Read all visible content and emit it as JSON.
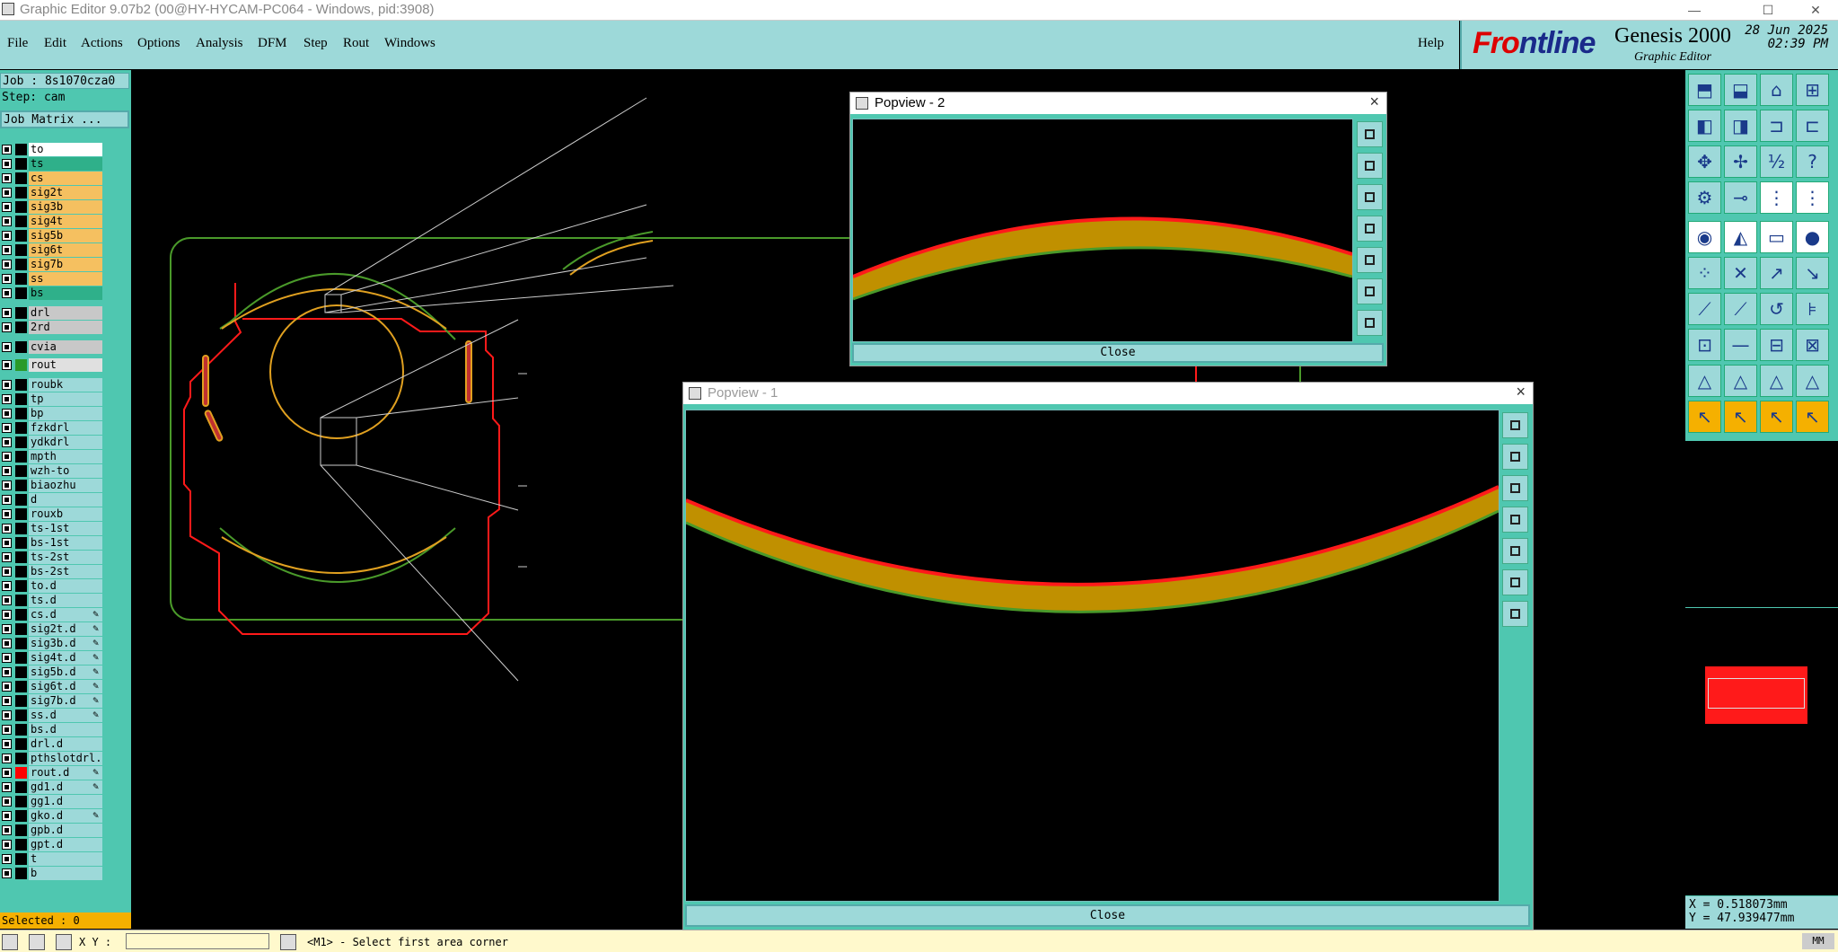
{
  "window": {
    "title": "Graphic Editor 9.07b2 (00@HY-HYCAM-PC064 - Windows, pid:3908)",
    "minimize": "—",
    "maximize": "☐",
    "close": "✕"
  },
  "menu": [
    "File",
    "Edit",
    "Actions",
    "Options",
    "Analysis",
    "DFM",
    "Step",
    "Rout",
    "Windows"
  ],
  "help_label": "Help",
  "brand": {
    "logo_main": "Fr",
    "logo_o": "o",
    "logo_rest": "ntline",
    "product": "Genesis 2000",
    "subtitle": "Graphic Editor",
    "date": "28 Jun 2025",
    "time": "02:39 PM"
  },
  "job": {
    "job_label": "Job : 8s1070cza0",
    "step_label": "Step: cam",
    "matrix_button": "Job Matrix ..."
  },
  "layers": [
    {
      "name": "to",
      "color": "#ffffff",
      "swatch": "#000000",
      "edit": ""
    },
    {
      "name": "ts",
      "color": "#2fb08a",
      "swatch": "#000000",
      "edit": ""
    },
    {
      "name": "cs",
      "color": "#f5c060",
      "swatch": "#000000",
      "edit": ""
    },
    {
      "name": "sig2t",
      "color": "#f5c060",
      "swatch": "#000000",
      "edit": ""
    },
    {
      "name": "sig3b",
      "color": "#f5c060",
      "swatch": "#000000",
      "edit": ""
    },
    {
      "name": "sig4t",
      "color": "#f5c060",
      "swatch": "#000000",
      "edit": ""
    },
    {
      "name": "sig5b",
      "color": "#f5c060",
      "swatch": "#000000",
      "edit": ""
    },
    {
      "name": "sig6t",
      "color": "#f5c060",
      "swatch": "#000000",
      "edit": ""
    },
    {
      "name": "sig7b",
      "color": "#f5c060",
      "swatch": "#000000",
      "edit": ""
    },
    {
      "name": "ss",
      "color": "#f5c060",
      "swatch": "#000000",
      "edit": ""
    },
    {
      "name": "bs",
      "color": "#2fb08a",
      "swatch": "#000000",
      "edit": ""
    },
    {
      "name": "drl",
      "color": "#c8c8c8",
      "swatch": "#000000",
      "edit": ""
    },
    {
      "name": "2rd",
      "color": "#c8c8c8",
      "swatch": "#000000",
      "edit": ""
    },
    {
      "name": "cvia",
      "color": "#c8c8c8",
      "swatch": "#000000",
      "edit": ""
    },
    {
      "name": "rout",
      "color": "#e0e0e0",
      "swatch": "#2a9a2a",
      "edit": ""
    },
    {
      "name": "roubk",
      "color": "#9dd9d9",
      "swatch": "#000000",
      "edit": ""
    },
    {
      "name": "tp",
      "color": "#9dd9d9",
      "swatch": "#000000",
      "edit": ""
    },
    {
      "name": "bp",
      "color": "#9dd9d9",
      "swatch": "#000000",
      "edit": ""
    },
    {
      "name": "fzkdrl",
      "color": "#9dd9d9",
      "swatch": "#000000",
      "edit": ""
    },
    {
      "name": "ydkdrl",
      "color": "#9dd9d9",
      "swatch": "#000000",
      "edit": ""
    },
    {
      "name": "mpth",
      "color": "#9dd9d9",
      "swatch": "#000000",
      "edit": ""
    },
    {
      "name": "wzh-to",
      "color": "#9dd9d9",
      "swatch": "#000000",
      "edit": ""
    },
    {
      "name": "biaozhu",
      "color": "#9dd9d9",
      "swatch": "#000000",
      "edit": ""
    },
    {
      "name": "d",
      "color": "#9dd9d9",
      "swatch": "#000000",
      "edit": ""
    },
    {
      "name": "rouxb",
      "color": "#9dd9d9",
      "swatch": "#000000",
      "edit": ""
    },
    {
      "name": "ts-1st",
      "color": "#9dd9d9",
      "swatch": "#000000",
      "edit": ""
    },
    {
      "name": "bs-1st",
      "color": "#9dd9d9",
      "swatch": "#000000",
      "edit": ""
    },
    {
      "name": "ts-2st",
      "color": "#9dd9d9",
      "swatch": "#000000",
      "edit": ""
    },
    {
      "name": "bs-2st",
      "color": "#9dd9d9",
      "swatch": "#000000",
      "edit": ""
    },
    {
      "name": "to.d",
      "color": "#9dd9d9",
      "swatch": "#000000",
      "edit": ""
    },
    {
      "name": "ts.d",
      "color": "#9dd9d9",
      "swatch": "#000000",
      "edit": ""
    },
    {
      "name": "cs.d",
      "color": "#9dd9d9",
      "swatch": "#000000",
      "edit": "✎"
    },
    {
      "name": "sig2t.d",
      "color": "#9dd9d9",
      "swatch": "#000000",
      "edit": "✎"
    },
    {
      "name": "sig3b.d",
      "color": "#9dd9d9",
      "swatch": "#000000",
      "edit": "✎"
    },
    {
      "name": "sig4t.d",
      "color": "#9dd9d9",
      "swatch": "#000000",
      "edit": "✎"
    },
    {
      "name": "sig5b.d",
      "color": "#9dd9d9",
      "swatch": "#000000",
      "edit": "✎"
    },
    {
      "name": "sig6t.d",
      "color": "#9dd9d9",
      "swatch": "#000000",
      "edit": "✎"
    },
    {
      "name": "sig7b.d",
      "color": "#9dd9d9",
      "swatch": "#000000",
      "edit": "✎"
    },
    {
      "name": "ss.d",
      "color": "#9dd9d9",
      "swatch": "#000000",
      "edit": "✎"
    },
    {
      "name": "bs.d",
      "color": "#9dd9d9",
      "swatch": "#000000",
      "edit": ""
    },
    {
      "name": "drl.d",
      "color": "#9dd9d9",
      "swatch": "#000000",
      "edit": ""
    },
    {
      "name": "pthslotdrl.d",
      "color": "#9dd9d9",
      "swatch": "#000000",
      "edit": ""
    },
    {
      "name": "rout.d",
      "color": "#9dd9d9",
      "swatch": "#ff0000",
      "edit": "✎"
    },
    {
      "name": "gd1.d",
      "color": "#9dd9d9",
      "swatch": "#000000",
      "edit": "✎"
    },
    {
      "name": "gg1.d",
      "color": "#9dd9d9",
      "swatch": "#000000",
      "edit": ""
    },
    {
      "name": "gko.d",
      "color": "#9dd9d9",
      "swatch": "#000000",
      "edit": "✎"
    },
    {
      "name": "gpb.d",
      "color": "#9dd9d9",
      "swatch": "#000000",
      "edit": ""
    },
    {
      "name": "gpt.d",
      "color": "#9dd9d9",
      "swatch": "#000000",
      "edit": ""
    },
    {
      "name": "t",
      "color": "#9dd9d9",
      "swatch": "#000000",
      "edit": ""
    },
    {
      "name": "b",
      "color": "#9dd9d9",
      "swatch": "#000000",
      "edit": ""
    }
  ],
  "selected_label": "Selected : 0",
  "popview2": {
    "title": "Popview - 2",
    "close_label": "Close"
  },
  "popview1": {
    "title": "Popview - 1",
    "close_label": "Close"
  },
  "coords": {
    "x": "X = 0.518073mm",
    "y": "Y = 47.939477mm"
  },
  "status": {
    "xy_label": "X Y :",
    "prompt": "<M1> - Select first area corner",
    "units": "MM"
  },
  "colors": {
    "panel": "#4fc7b0",
    "button": "#9dd9d9",
    "trace_red": "#ff1a1a",
    "trace_green": "#4a9a2a",
    "trace_orange": "#e0a020"
  }
}
